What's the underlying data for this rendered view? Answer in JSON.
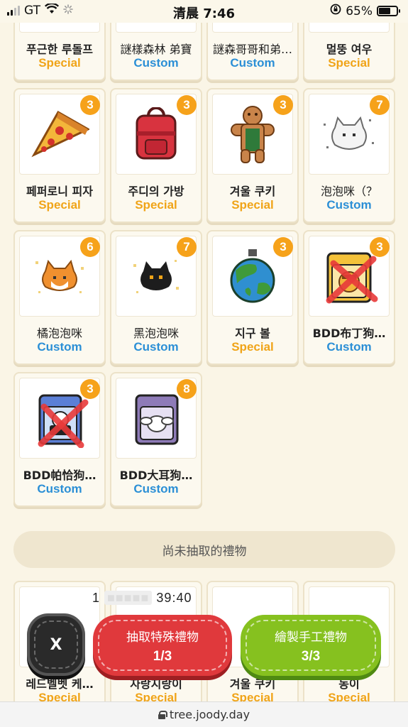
{
  "status": {
    "carrier": "GT",
    "time": "清晨 7:46",
    "battery": "65%",
    "battery_level": 0.65
  },
  "gifts_row1": [
    {
      "name": "푸근한 루돌프",
      "type": "Special"
    },
    {
      "name": "謎樣森林 弟寶",
      "type": "Custom"
    },
    {
      "name": "謎森哥哥和弟…",
      "type": "Custom"
    },
    {
      "name": "멀뚱 여우",
      "type": "Special"
    }
  ],
  "gifts_row2": [
    {
      "name": "페퍼로니 피자",
      "type": "Special",
      "count": "3",
      "icon": "pizza-icon"
    },
    {
      "name": "주디의 가방",
      "type": "Special",
      "count": "3",
      "icon": "backpack-icon"
    },
    {
      "name": "겨울 쿠키",
      "type": "Special",
      "count": "3",
      "icon": "gingerbread-icon"
    },
    {
      "name": "泡泡咪（？",
      "type": "Custom",
      "count": "7",
      "icon": "white-cat-icon"
    }
  ],
  "gifts_row3": [
    {
      "name": "橘泡泡咪",
      "type": "Custom",
      "count": "6",
      "icon": "orange-cat-icon"
    },
    {
      "name": "黑泡泡咪",
      "type": "Custom",
      "count": "7",
      "icon": "black-cat-icon"
    },
    {
      "name": "지구 볼",
      "type": "Special",
      "count": "3",
      "icon": "earth-ornament-icon"
    },
    {
      "name": "BDD布丁狗…",
      "type": "Custom",
      "count": "3",
      "icon": "pompompurin-box-icon"
    }
  ],
  "gifts_row4": [
    {
      "name": "BDD帕恰狗…",
      "type": "Custom",
      "count": "3",
      "icon": "pochacco-box-icon"
    },
    {
      "name": "BDD大耳狗…",
      "type": "Custom",
      "count": "8",
      "icon": "cinnamoroll-box-icon"
    }
  ],
  "section": {
    "undrawn_title": "尚未抽取的禮物"
  },
  "undrawn": [
    {
      "name": "레드벨벳 케…",
      "type": "Special"
    },
    {
      "name": "자랑지랑이",
      "type": "Special"
    },
    {
      "name": "겨울 쿠키",
      "type": "Special"
    },
    {
      "name": "동이",
      "type": "Special"
    }
  ],
  "timer": {
    "prefix": "1",
    "suffix": "39:40"
  },
  "actions": {
    "close_label": "X",
    "draw_label": "抽取特殊禮物",
    "draw_count": "1/3",
    "paint_label": "繪製手工禮物",
    "paint_count": "3/3"
  },
  "url": "tree.joody.day",
  "colors": {
    "special": "#f0a418",
    "custom": "#2b8fd6",
    "draw_button": "#e0393c",
    "paint_button": "#86c11f",
    "badge": "#f6a21a"
  }
}
